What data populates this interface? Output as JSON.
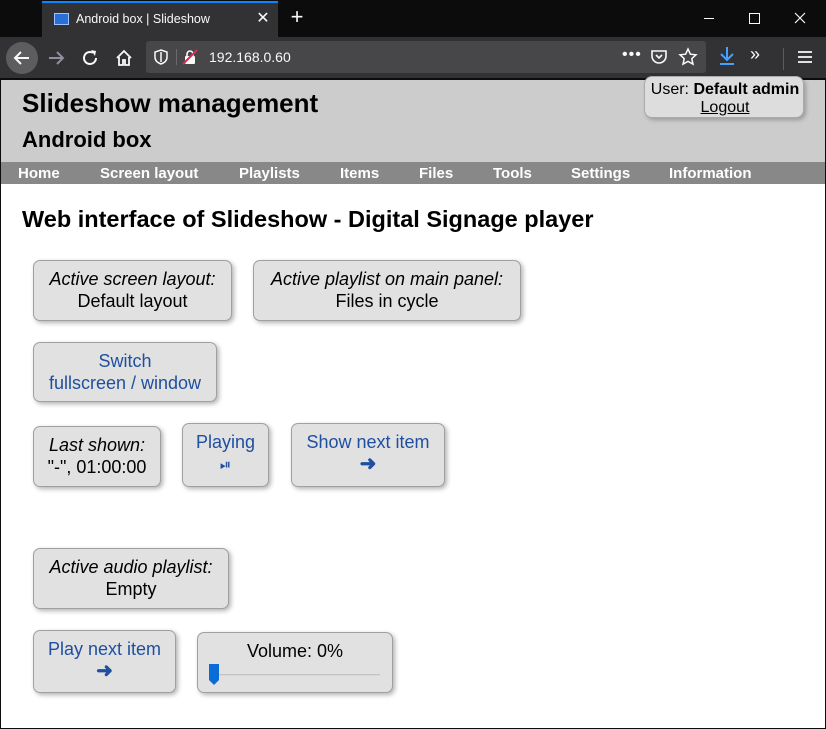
{
  "browser": {
    "tab_title": "Android box | Slideshow",
    "url": "192.168.0.60",
    "url_dots": "•••",
    "icons": [
      "back-arrow-icon",
      "forward-arrow-icon",
      "reload-icon",
      "home-icon",
      "shield-icon",
      "insecure-lock-icon",
      "pocket-icon",
      "star-icon",
      "download-icon",
      "overflow-chevron-icon",
      "hamburger-menu-icon"
    ]
  },
  "header": {
    "title": "Slideshow management",
    "subtitle": "Android box",
    "user_label": "User: ",
    "user_name": "Default admin",
    "logout": "Logout"
  },
  "menu": {
    "items": [
      "Home",
      "Screen layout",
      "Playlists",
      "Items",
      "Files",
      "Tools",
      "Settings",
      "Information"
    ]
  },
  "main": {
    "heading": "Web interface of Slideshow - Digital Signage player",
    "active_layout": {
      "label": "Active screen layout:",
      "value": "Default layout"
    },
    "active_playlist": {
      "label": "Active playlist on main panel:",
      "value": "Files in cycle"
    },
    "switch_button": {
      "line1": "Switch",
      "line2": "fullscreen / window"
    },
    "last_shown": {
      "label": "Last shown:",
      "value": "\"-\", 01:00:00"
    },
    "playing_button": {
      "label": "Playing",
      "glyph": "⏯"
    },
    "show_next_button": {
      "label": "Show next item",
      "arrow": "➜"
    },
    "audio_playlist": {
      "label": "Active audio playlist:",
      "value": "Empty"
    },
    "play_next_button": {
      "label": "Play next item",
      "arrow": "➜"
    },
    "volume": {
      "label": "Volume: 0%",
      "level": 0
    }
  },
  "colors": {
    "header_bg": "#cccccc",
    "menu_bg": "#888888",
    "action_text": "#1f4fa0",
    "card_bg": "#e1e1e1",
    "slider_thumb": "#0a6cd6"
  }
}
